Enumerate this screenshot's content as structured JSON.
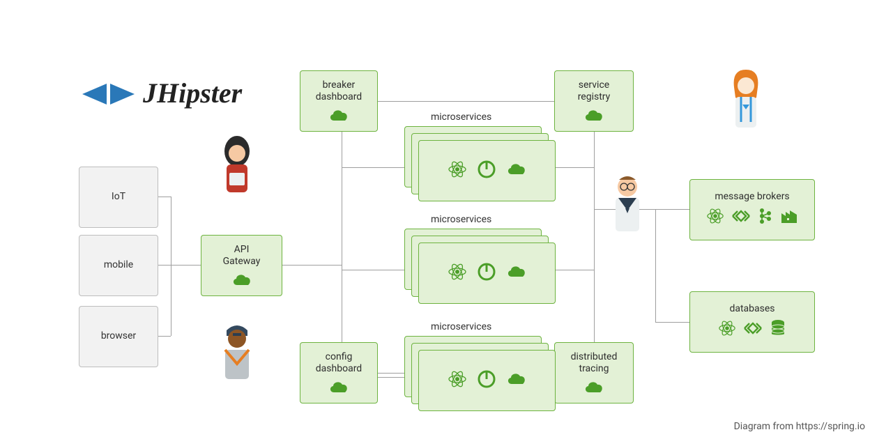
{
  "logo": {
    "text": "JHipster"
  },
  "clients": {
    "iot": "IoT",
    "mobile": "mobile",
    "browser": "browser"
  },
  "gateway": {
    "label": "API\nGateway"
  },
  "breaker": {
    "label": "breaker\ndashboard"
  },
  "config": {
    "label": "config\ndashboard"
  },
  "registry": {
    "label": "service\nregistry"
  },
  "tracing": {
    "label": "distributed\ntracing"
  },
  "microservices_label": "microservices",
  "brokers": {
    "label": "message brokers"
  },
  "databases": {
    "label": "databases"
  },
  "attribution": "Diagram from https://spring.io"
}
